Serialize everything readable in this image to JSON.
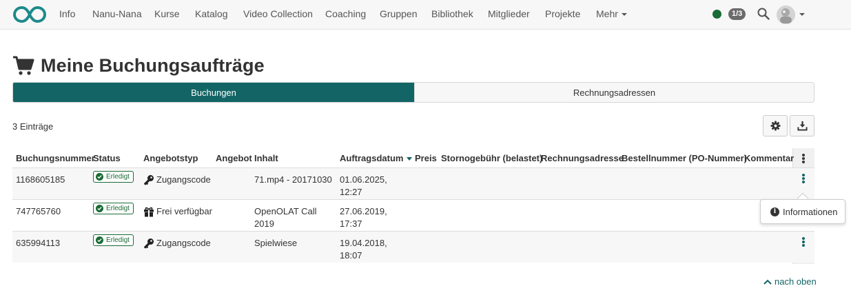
{
  "nav": {
    "items": [
      {
        "id": "info",
        "label": "Info"
      },
      {
        "id": "nanu-nana",
        "label": "Nanu-Nana"
      },
      {
        "id": "kurse",
        "label": "Kurse"
      },
      {
        "id": "katalog",
        "label": "Katalog"
      },
      {
        "id": "video-collection",
        "label": "Video Collection"
      },
      {
        "id": "coaching",
        "label": "Coaching"
      },
      {
        "id": "gruppen",
        "label": "Gruppen"
      },
      {
        "id": "bibliothek",
        "label": "Bibliothek"
      },
      {
        "id": "mitglieder",
        "label": "Mitglieder"
      },
      {
        "id": "projekte",
        "label": "Projekte"
      },
      {
        "id": "mehr",
        "label": "Mehr"
      }
    ],
    "session_count": "1/3",
    "online_color": "#1a6b35"
  },
  "page": {
    "title": "Meine Buchungsaufträge"
  },
  "tabs": [
    {
      "label": "Buchungen",
      "active": true
    },
    {
      "label": "Rechnungsadressen",
      "active": false
    }
  ],
  "table": {
    "entries_label": "3 Einträge",
    "columns": [
      "Buchungsnummer",
      "Status",
      "Angebotstyp",
      "Angebot",
      "Inhalt",
      "Auftragsdatum",
      "Preis",
      "Stornogebühr (belastet)",
      "Rechnungsadresse",
      "Bestellnummer (PO-Nummer)",
      "Kommentar"
    ],
    "sorted_column": "Auftragsdatum",
    "rows": [
      {
        "number": "1168605185",
        "status": "Erledigt",
        "offer_type": "Zugangscode",
        "offer_type_icon": "key-icon",
        "content": "71.mp4 - 20171030",
        "date": "01.06.2025,",
        "time": "12:27"
      },
      {
        "number": "747765760",
        "status": "Erledigt",
        "offer_type": "Frei verfügbar",
        "offer_type_icon": "gift-icon",
        "content": "OpenOLAT Call",
        "content2": "2019",
        "date": "27.06.2019,",
        "time": "17:37"
      },
      {
        "number": "635994113",
        "status": "Erledigt",
        "offer_type": "Zugangscode",
        "offer_type_icon": "key-icon",
        "content": "Spielwiese",
        "date": "19.04.2018,",
        "time": "18:07"
      }
    ]
  },
  "popover": {
    "label": "Informationen"
  },
  "footer": {
    "back_to_top": "nach oben"
  },
  "colors": {
    "accent": "#136565",
    "status_green": "#1a6b35"
  }
}
